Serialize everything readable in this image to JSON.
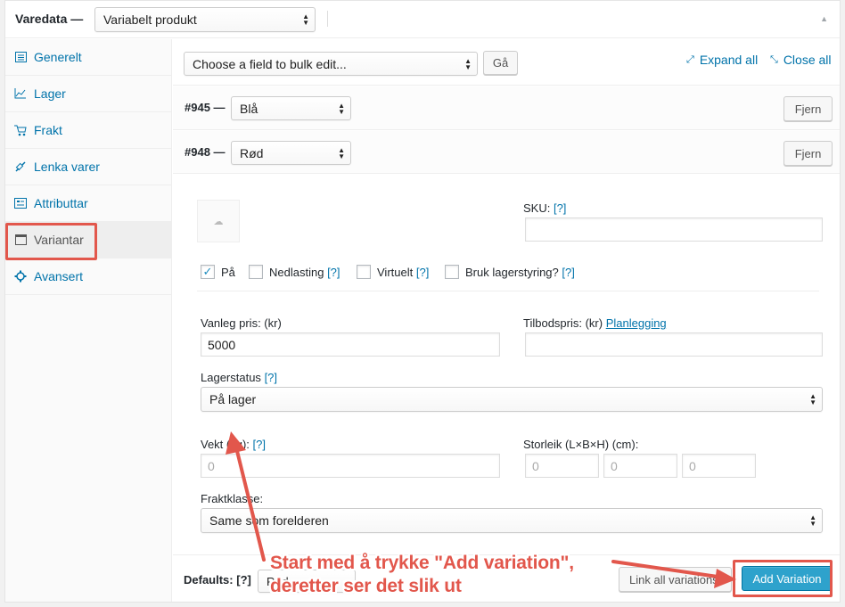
{
  "header": {
    "title": "Varedata —",
    "product_type": "Variabelt produkt"
  },
  "sidebar": {
    "items": [
      {
        "label": "Generelt",
        "icon": "general-icon"
      },
      {
        "label": "Lager",
        "icon": "inventory-icon"
      },
      {
        "label": "Frakt",
        "icon": "shipping-icon"
      },
      {
        "label": "Lenka varer",
        "icon": "linked-products-icon"
      },
      {
        "label": "Attributtar",
        "icon": "attributes-icon"
      },
      {
        "label": "Variantar",
        "icon": "variations-icon"
      },
      {
        "label": "Avansert",
        "icon": "advanced-icon"
      }
    ],
    "active": "Variantar"
  },
  "toolbar": {
    "bulk_edit_placeholder": "Choose a field to bulk edit...",
    "go_label": "Gå",
    "expand_all": "Expand all",
    "close_all": "Close all"
  },
  "variations": [
    {
      "number": "#945 —",
      "value": "Blå",
      "remove_label": "Fjern"
    },
    {
      "number": "#948 —",
      "value": "Rød",
      "remove_label": "Fjern"
    }
  ],
  "form": {
    "sku_label": "SKU:",
    "help": "[?]",
    "checkboxes": [
      {
        "label": "På",
        "checked": true,
        "help": false
      },
      {
        "label": "Nedlasting",
        "checked": false,
        "help": true
      },
      {
        "label": "Virtuelt",
        "checked": false,
        "help": true
      },
      {
        "label": "Bruk lagerstyring?",
        "checked": false,
        "help": true
      }
    ],
    "regular_price_label": "Vanleg pris: (kr)",
    "regular_price_value": "5000",
    "sale_price_label": "Tilbodspris: (kr)",
    "schedule_link": "Planlegging",
    "stock_status_label": "Lagerstatus",
    "stock_status_value": "På lager",
    "weight_label": "Vekt (kg):",
    "weight_placeholder": "0",
    "dimensions_label": "Storleik (L×B×H) (cm):",
    "dim_placeholders": [
      "0",
      "0",
      "0"
    ],
    "shipping_class_label": "Fraktklasse:",
    "shipping_class_value": "Same som forelderen"
  },
  "bottom": {
    "defaults_label": "Defaults:",
    "defaults_value": "Rød",
    "link_all_label": "Link all variations",
    "add_variation_label": "Add Variation"
  },
  "annotation": {
    "line1": "Start med å trykke \"Add variation\",",
    "line2": "deretter ser det slik ut",
    "color": "#e2574c"
  }
}
